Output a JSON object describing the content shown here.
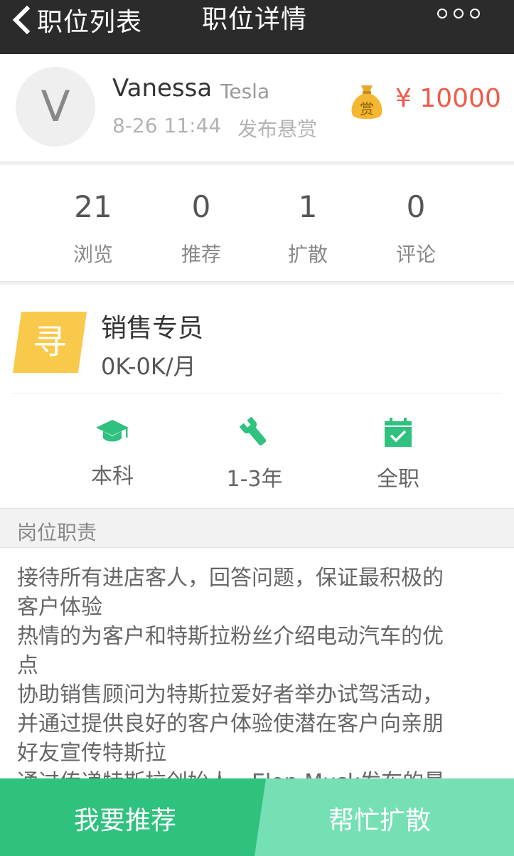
{
  "nav": {
    "back_label": "职位列表",
    "title": "职位详情"
  },
  "poster": {
    "avatar_letter": "V",
    "name": "Vanessa",
    "company": "Tesla",
    "time": "8-26 11:44",
    "action": "发布悬赏",
    "bag_char": "赏",
    "reward": "¥ 10000"
  },
  "stats": [
    {
      "value": "21",
      "label": "浏览"
    },
    {
      "value": "0",
      "label": "推荐"
    },
    {
      "value": "1",
      "label": "扩散"
    },
    {
      "value": "0",
      "label": "评论"
    }
  ],
  "job": {
    "badge": "寻",
    "title": "销售专员",
    "salary": "0K-0K/月",
    "requirements": [
      {
        "icon": "graduation-cap-icon",
        "label": "本科"
      },
      {
        "icon": "wrench-icon",
        "label": "1-3年"
      },
      {
        "icon": "calendar-check-icon",
        "label": "全职"
      }
    ]
  },
  "section": {
    "title": "岗位职责",
    "lines": [
      "接待所有进店客人，回答问题，保证最积极的",
      "客户体验",
      "热情的为客户和特斯拉粉丝介绍电动汽车的优",
      "点",
      "协助销售顾问为特斯拉爱好者举办试驾活动，",
      "并通过提供良好的客户体验使潜在客户向亲朋",
      "好友宣传特斯拉",
      "通过传递特斯拉创始人，Elon Musk发布的最"
    ]
  },
  "actions": {
    "recommend": "我要推荐",
    "spread": "帮忙扩散"
  },
  "colors": {
    "topbar": "#2b2b2b",
    "reward": "#f05a4a",
    "accent_green": "#2fc17e",
    "light_green": "#74e0b3",
    "badge_yellow": "#f8c94a"
  }
}
